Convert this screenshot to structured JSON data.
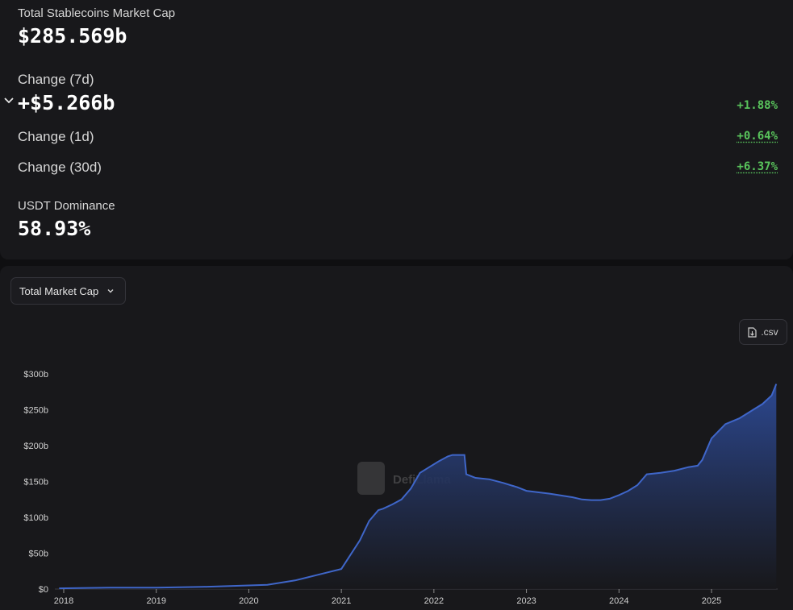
{
  "summary": {
    "market_cap_label": "Total Stablecoins Market Cap",
    "market_cap_value": "$285.569b",
    "change_7d_label": "Change (7d)",
    "change_7d_value": "+$5.266b",
    "change_7d_pct": "+1.88%",
    "change_1d_label": "Change (1d)",
    "change_1d_pct": "+0.64%",
    "change_30d_label": "Change (30d)",
    "change_30d_pct": "+6.37%",
    "dominance_label": "USDT Dominance",
    "dominance_value": "58.93%"
  },
  "controls": {
    "dropdown_label": "Total Market Cap",
    "csv_label": ".csv"
  },
  "watermark": "DefiLlama",
  "colors": {
    "positive": "#59c45c",
    "series_line": "#3f66c9",
    "area_top": "#2d4a96",
    "background": "#18181b"
  },
  "chart_data": {
    "type": "area",
    "title": "",
    "xlabel": "",
    "ylabel": "",
    "x_tick_labels": [
      "2018",
      "2019",
      "2020",
      "2021",
      "2022",
      "2023",
      "2024",
      "2025"
    ],
    "y_tick_labels": [
      "$0",
      "$50b",
      "$100b",
      "$150b",
      "$200b",
      "$250b",
      "$300b"
    ],
    "ylim": [
      0,
      300
    ],
    "y_unit": "billions USD",
    "grid": false,
    "legend": "none",
    "series": [
      {
        "x": [
          2017.95,
          2018.5,
          2019.0,
          2019.5,
          2020.0,
          2020.2,
          2020.5,
          2020.75,
          2021.0,
          2021.1,
          2021.2,
          2021.3,
          2021.4,
          2021.45,
          2021.55,
          2021.65,
          2021.75,
          2021.85,
          2021.95,
          2022.05,
          2022.15,
          2022.2,
          2022.25,
          2022.33,
          2022.35,
          2022.45,
          2022.6,
          2022.75,
          2022.9,
          2023.0,
          2023.25,
          2023.5,
          2023.6,
          2023.7,
          2023.8,
          2023.9,
          2024.0,
          2024.1,
          2024.2,
          2024.3,
          2024.45,
          2024.6,
          2024.75,
          2024.85,
          2024.9,
          2025.0,
          2025.15,
          2025.3,
          2025.45,
          2025.55,
          2025.65,
          2025.7
        ],
        "y": [
          1,
          2,
          2,
          3,
          5,
          6,
          12,
          20,
          28,
          48,
          68,
          95,
          110,
          112,
          118,
          125,
          140,
          162,
          170,
          178,
          185,
          187,
          187,
          187,
          160,
          155,
          153,
          148,
          142,
          137,
          133,
          128,
          125,
          124,
          124,
          126,
          131,
          137,
          145,
          160,
          162,
          165,
          170,
          172,
          180,
          210,
          230,
          238,
          250,
          258,
          270,
          286
        ]
      }
    ]
  }
}
